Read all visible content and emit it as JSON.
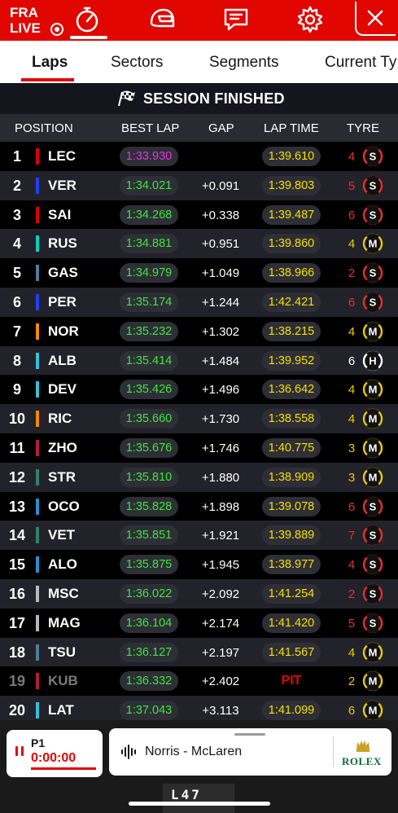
{
  "topbar": {
    "country": "FRA",
    "live": "LIVE"
  },
  "tabs": [
    {
      "label": "Laps"
    },
    {
      "label": "Sectors"
    },
    {
      "label": "Segments"
    },
    {
      "label": "Current Ty"
    }
  ],
  "banner": {
    "text": "SESSION FINISHED"
  },
  "columns": {
    "position": "POSITION",
    "best_lap": "BEST LAP",
    "gap": "GAP",
    "lap_time": "LAP TIME",
    "tyre": "TYRE"
  },
  "rows": [
    {
      "pos": "1",
      "driver": "LEC",
      "team_color": "#dc0000",
      "best": "1:33.930",
      "best_purple": true,
      "gap": "",
      "lap_time": "1:39.610",
      "laps": "4",
      "laps_color": "#e8302a",
      "tyre": "S"
    },
    {
      "pos": "2",
      "driver": "VER",
      "team_color": "#1e41ff",
      "best": "1:34.021",
      "gap": "+0.091",
      "lap_time": "1:39.803",
      "laps": "5",
      "laps_color": "#e8302a",
      "tyre": "S"
    },
    {
      "pos": "3",
      "driver": "SAI",
      "team_color": "#dc0000",
      "best": "1:34.268",
      "gap": "+0.338",
      "lap_time": "1:39.487",
      "laps": "6",
      "laps_color": "#e8302a",
      "tyre": "S"
    },
    {
      "pos": "4",
      "driver": "RUS",
      "team_color": "#00d2be",
      "best": "1:34.881",
      "gap": "+0.951",
      "lap_time": "1:39.860",
      "laps": "4",
      "laps_color": "#f0c800",
      "tyre": "M"
    },
    {
      "pos": "5",
      "driver": "GAS",
      "team_color": "#4e7c9b",
      "best": "1:34.979",
      "gap": "+1.049",
      "lap_time": "1:38.966",
      "laps": "2",
      "laps_color": "#e8302a",
      "tyre": "S"
    },
    {
      "pos": "6",
      "driver": "PER",
      "team_color": "#1e41ff",
      "best": "1:35.174",
      "gap": "+1.244",
      "lap_time": "1:42.421",
      "laps": "6",
      "laps_color": "#e8302a",
      "tyre": "S"
    },
    {
      "pos": "7",
      "driver": "NOR",
      "team_color": "#ff8700",
      "best": "1:35.232",
      "gap": "+1.302",
      "lap_time": "1:38.215",
      "laps": "4",
      "laps_color": "#f0c800",
      "tyre": "M"
    },
    {
      "pos": "8",
      "driver": "ALB",
      "team_color": "#37bedd",
      "best": "1:35.414",
      "gap": "+1.484",
      "lap_time": "1:39.952",
      "laps": "6",
      "laps_color": "#ffffff",
      "tyre": "H"
    },
    {
      "pos": "9",
      "driver": "DEV",
      "team_color": "#37bedd",
      "best": "1:35.426",
      "gap": "+1.496",
      "lap_time": "1:36.642",
      "laps": "4",
      "laps_color": "#f0c800",
      "tyre": "M"
    },
    {
      "pos": "10",
      "driver": "RIC",
      "team_color": "#ff8700",
      "best": "1:35.660",
      "gap": "+1.730",
      "lap_time": "1:38.558",
      "laps": "4",
      "laps_color": "#f0c800",
      "tyre": "M"
    },
    {
      "pos": "11",
      "driver": "ZHO",
      "team_color": "#b12039",
      "best": "1:35.676",
      "gap": "+1.746",
      "lap_time": "1:40.775",
      "laps": "3",
      "laps_color": "#f0c800",
      "tyre": "M"
    },
    {
      "pos": "12",
      "driver": "STR",
      "team_color": "#2d826d",
      "best": "1:35.810",
      "gap": "+1.880",
      "lap_time": "1:38.909",
      "laps": "3",
      "laps_color": "#f0c800",
      "tyre": "M"
    },
    {
      "pos": "13",
      "driver": "OCO",
      "team_color": "#2293d1",
      "best": "1:35.828",
      "gap": "+1.898",
      "lap_time": "1:39.078",
      "laps": "6",
      "laps_color": "#e8302a",
      "tyre": "S"
    },
    {
      "pos": "14",
      "driver": "VET",
      "team_color": "#2d826d",
      "best": "1:35.851",
      "gap": "+1.921",
      "lap_time": "1:39.889",
      "laps": "7",
      "laps_color": "#e8302a",
      "tyre": "S"
    },
    {
      "pos": "15",
      "driver": "ALO",
      "team_color": "#2293d1",
      "best": "1:35.875",
      "gap": "+1.945",
      "lap_time": "1:38.977",
      "laps": "4",
      "laps_color": "#e8302a",
      "tyre": "S"
    },
    {
      "pos": "16",
      "driver": "MSC",
      "team_color": "#b6babd",
      "best": "1:36.022",
      "gap": "+2.092",
      "lap_time": "1:41.254",
      "laps": "2",
      "laps_color": "#e8302a",
      "tyre": "S"
    },
    {
      "pos": "17",
      "driver": "MAG",
      "team_color": "#b6babd",
      "best": "1:36.104",
      "gap": "+2.174",
      "lap_time": "1:41.420",
      "laps": "5",
      "laps_color": "#e8302a",
      "tyre": "S"
    },
    {
      "pos": "18",
      "driver": "TSU",
      "team_color": "#4e7c9b",
      "best": "1:36.127",
      "gap": "+2.197",
      "lap_time": "1:41.567",
      "laps": "4",
      "laps_color": "#f0c800",
      "tyre": "M"
    },
    {
      "pos": "19",
      "driver": "KUB",
      "team_color": "#b12039",
      "best": "1:36.332",
      "gap": "+2.402",
      "lap_time": "PIT",
      "pit": true,
      "retired": true,
      "laps": "2",
      "laps_color": "#f0c800",
      "tyre": "M"
    },
    {
      "pos": "20",
      "driver": "LAT",
      "team_color": "#37bedd",
      "best": "1:37.043",
      "gap": "+3.113",
      "lap_time": "1:41.099",
      "laps": "6",
      "laps_color": "#f0c800",
      "tyre": "M"
    }
  ],
  "bottom": {
    "p1_label": "P1",
    "p1_time": "0:00:00",
    "radio_text": "Norris - McLaren",
    "sponsor": "ROLEX",
    "car_number": "L47"
  }
}
